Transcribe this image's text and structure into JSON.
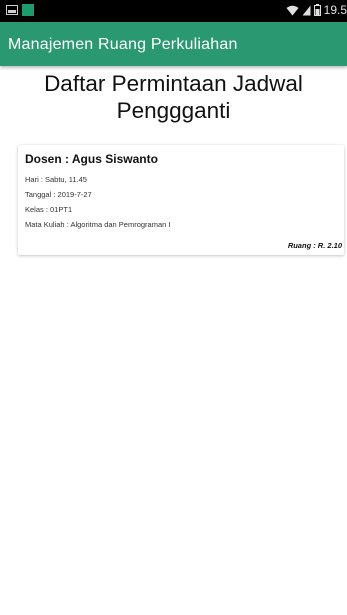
{
  "status_bar": {
    "time": "19.5",
    "icons": [
      "gallery-icon",
      "app-notification-icon",
      "wifi-icon",
      "signal-icon",
      "battery-icon"
    ]
  },
  "app_bar": {
    "title": "Manajemen Ruang Perkuliahan",
    "color": "#2a9871"
  },
  "page": {
    "title_line1": "Daftar Permintaan Jadwal",
    "title_line2": "Penggganti"
  },
  "requests": [
    {
      "dosen": "Dosen : Agus Siswanto",
      "hari": "Hari : Sabtu, 11.45",
      "tanggal": "Tanggal : 2019-7-27",
      "kelas": "Kelas : 01PT1",
      "mata_kuliah": "Mata Kuliah : Algoritma dan Pemrograman I",
      "ruang": "Ruang : R. 2.10"
    }
  ]
}
